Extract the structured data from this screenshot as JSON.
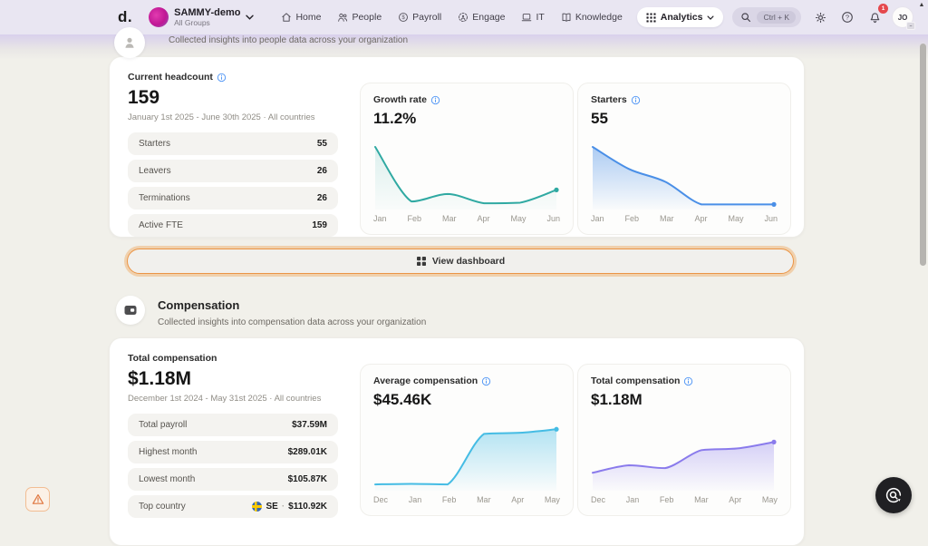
{
  "header": {
    "logo": "d.",
    "workspace_name": "SAMMY-demo",
    "workspace_subtitle": "All Groups",
    "nav": [
      {
        "label": "Home",
        "icon": "home-icon"
      },
      {
        "label": "People",
        "icon": "people-icon"
      },
      {
        "label": "Payroll",
        "icon": "payroll-icon"
      },
      {
        "label": "Engage",
        "icon": "engage-icon"
      },
      {
        "label": "IT",
        "icon": "laptop-icon"
      },
      {
        "label": "Knowledge",
        "icon": "book-icon"
      }
    ],
    "analytics_label": "Analytics",
    "search_shortcut": "Ctrl + K",
    "notification_count": "1",
    "user_initials": "JO",
    "icons": [
      "search-icon",
      "gear-icon",
      "help-icon",
      "bell-icon"
    ]
  },
  "people_section": {
    "subtitle": "Collected insights into people data across your organization"
  },
  "headcount_card": {
    "title": "Current headcount",
    "value": "159",
    "period": "January 1st 2025 - June 30th 2025 · All countries",
    "rows": [
      {
        "label": "Starters",
        "value": "55"
      },
      {
        "label": "Leavers",
        "value": "26"
      },
      {
        "label": "Terminations",
        "value": "26"
      },
      {
        "label": "Active FTE",
        "value": "159"
      }
    ]
  },
  "view_dashboard_label": "View dashboard",
  "compensation_section": {
    "title": "Compensation",
    "subtitle": "Collected insights into compensation data across your organization"
  },
  "compensation_card": {
    "title": "Total compensation",
    "value": "$1.18M",
    "period": "December 1st 2024 - May 31st 2025 · All countries",
    "rows": [
      {
        "label": "Total payroll",
        "value": "$37.59M"
      },
      {
        "label": "Highest month",
        "value": "$289.01K"
      },
      {
        "label": "Lowest month",
        "value": "$105.87K"
      },
      {
        "label": "Top country",
        "country_code": "SE",
        "sep": "·",
        "value": "$110.92K",
        "flag": "sweden-flag-icon"
      }
    ]
  },
  "chart_data": [
    {
      "type": "area",
      "title": "Growth rate",
      "value_label": "11.2%",
      "x": [
        "Jan",
        "Feb",
        "Mar",
        "Apr",
        "May",
        "Jun"
      ],
      "values": [
        100,
        6,
        19,
        3,
        4,
        26
      ],
      "color": "#2FA9A2",
      "fill_opacity": 0.16,
      "ylim": [
        0,
        100
      ],
      "legend": "none",
      "grid": false
    },
    {
      "type": "area",
      "title": "Starters",
      "value_label": "55",
      "x": [
        "Jan",
        "Feb",
        "Mar",
        "Apr",
        "May",
        "Jun"
      ],
      "values": [
        100,
        62,
        40,
        1,
        1,
        1
      ],
      "color": "#4A8FE7",
      "fill_opacity": 0.45,
      "ylim": [
        0,
        100
      ],
      "legend": "none",
      "grid": false
    },
    {
      "type": "area",
      "title": "Average compensation",
      "value_label": "$45.46K",
      "x": [
        "Dec",
        "Jan",
        "Feb",
        "Mar",
        "Apr",
        "May"
      ],
      "values": [
        3,
        4,
        3,
        90,
        92,
        98
      ],
      "color": "#45BCE4",
      "fill_opacity": 0.4,
      "ylim": [
        0,
        100
      ],
      "legend": "none",
      "grid": false
    },
    {
      "type": "area",
      "title": "Total compensation",
      "value_label": "$1.18M",
      "x": [
        "Dec",
        "Jan",
        "Feb",
        "Mar",
        "Apr",
        "May"
      ],
      "values": [
        23,
        36,
        31,
        62,
        65,
        76
      ],
      "color": "#8A7BEC",
      "fill_opacity": 0.35,
      "ylim": [
        0,
        100
      ],
      "legend": "none",
      "grid": false
    }
  ],
  "colors": {
    "topbar_bg": "#E9E6F2",
    "page_bg": "#F1F0EA",
    "focus_ring": "#EB9546",
    "notification_badge": "#E5484D",
    "info_icon": "#4D94F5"
  }
}
